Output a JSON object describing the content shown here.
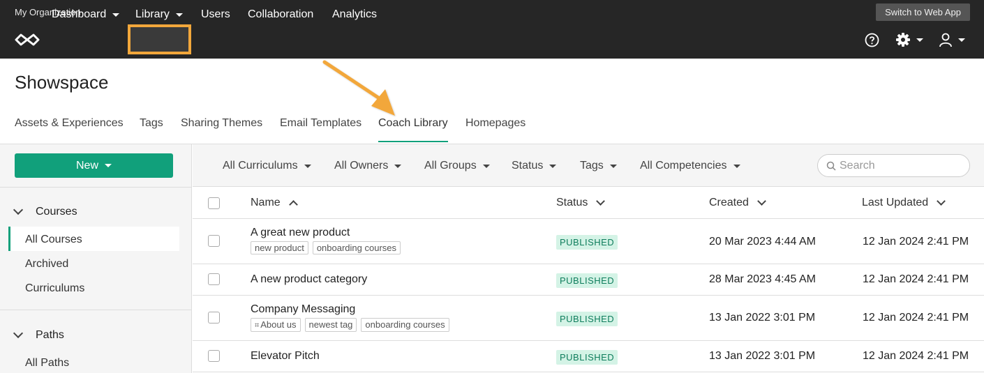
{
  "topbar": {
    "org_name": "My Organization",
    "switch_label": "Switch to Web App",
    "nav": [
      "Dashboard",
      "Library",
      "Users",
      "Collaboration",
      "Analytics"
    ],
    "highlight_color": "#f2a73b"
  },
  "header": {
    "title": "Showspace",
    "tabs": [
      "Assets & Experiences",
      "Tags",
      "Sharing Themes",
      "Email Templates",
      "Coach Library",
      "Homepages"
    ],
    "active_tab": "Coach Library"
  },
  "sidebar": {
    "new_label": "New",
    "courses_heading": "Courses",
    "courses_items": [
      "All Courses",
      "Archived",
      "Curriculums"
    ],
    "paths_heading": "Paths",
    "paths_items": [
      "All Paths"
    ]
  },
  "filters": {
    "items": [
      "All Curriculums",
      "All Owners",
      "All Groups",
      "Status",
      "Tags",
      "All Competencies"
    ],
    "search_placeholder": "Search"
  },
  "table": {
    "columns": [
      "Name",
      "Status",
      "Created",
      "Last Updated"
    ],
    "rows": [
      {
        "name": "A great new product",
        "tags": [
          "new product",
          "onboarding courses"
        ],
        "status": "PUBLISHED",
        "created": "20 Mar 2023 4:44 AM",
        "updated": "12 Jan 2024 2:41 PM"
      },
      {
        "name": "A new product category",
        "tags": [],
        "status": "PUBLISHED",
        "created": "28 Mar 2023 4:45 AM",
        "updated": "12 Jan 2024 2:41 PM"
      },
      {
        "name": "Company Messaging",
        "tags": [
          "About us",
          "newest tag",
          "onboarding courses"
        ],
        "status": "PUBLISHED",
        "created": "13 Jan 2022 3:01 PM",
        "updated": "12 Jan 2024 2:41 PM"
      },
      {
        "name": "Elevator Pitch",
        "tags": [],
        "status": "PUBLISHED",
        "created": "13 Jan 2022 3:01 PM",
        "updated": "12 Jan 2024 2:41 PM"
      }
    ]
  },
  "colors": {
    "accent": "#11a07b",
    "topbar": "#262626",
    "badge_bg": "#d4f3e6"
  }
}
